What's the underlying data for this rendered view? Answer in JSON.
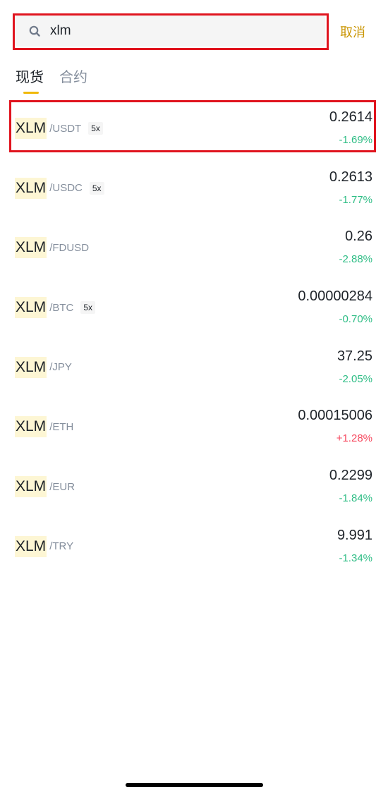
{
  "search": {
    "value": "xlm",
    "cancel_label": "取消"
  },
  "tabs": [
    {
      "label": "现货",
      "active": true
    },
    {
      "label": "合约",
      "active": false
    }
  ],
  "colors": {
    "accent": "#f0b90b",
    "cancel": "#c99400",
    "down": "#2ebd85",
    "up": "#f6465d",
    "highlight_border": "#e0141e"
  },
  "pairs": [
    {
      "base": "XLM",
      "quote": "/USDT",
      "leverage": "5x",
      "price": "0.2614",
      "change": "-1.69%",
      "direction": "down"
    },
    {
      "base": "XLM",
      "quote": "/USDC",
      "leverage": "5x",
      "price": "0.2613",
      "change": "-1.77%",
      "direction": "down"
    },
    {
      "base": "XLM",
      "quote": "/FDUSD",
      "leverage": "",
      "price": "0.26",
      "change": "-2.88%",
      "direction": "down"
    },
    {
      "base": "XLM",
      "quote": "/BTC",
      "leverage": "5x",
      "price": "0.00000284",
      "change": "-0.70%",
      "direction": "down"
    },
    {
      "base": "XLM",
      "quote": "/JPY",
      "leverage": "",
      "price": "37.25",
      "change": "-2.05%",
      "direction": "down"
    },
    {
      "base": "XLM",
      "quote": "/ETH",
      "leverage": "",
      "price": "0.00015006",
      "change": "+1.28%",
      "direction": "up"
    },
    {
      "base": "XLM",
      "quote": "/EUR",
      "leverage": "",
      "price": "0.2299",
      "change": "-1.84%",
      "direction": "down"
    },
    {
      "base": "XLM",
      "quote": "/TRY",
      "leverage": "",
      "price": "9.991",
      "change": "-1.34%",
      "direction": "down"
    }
  ]
}
